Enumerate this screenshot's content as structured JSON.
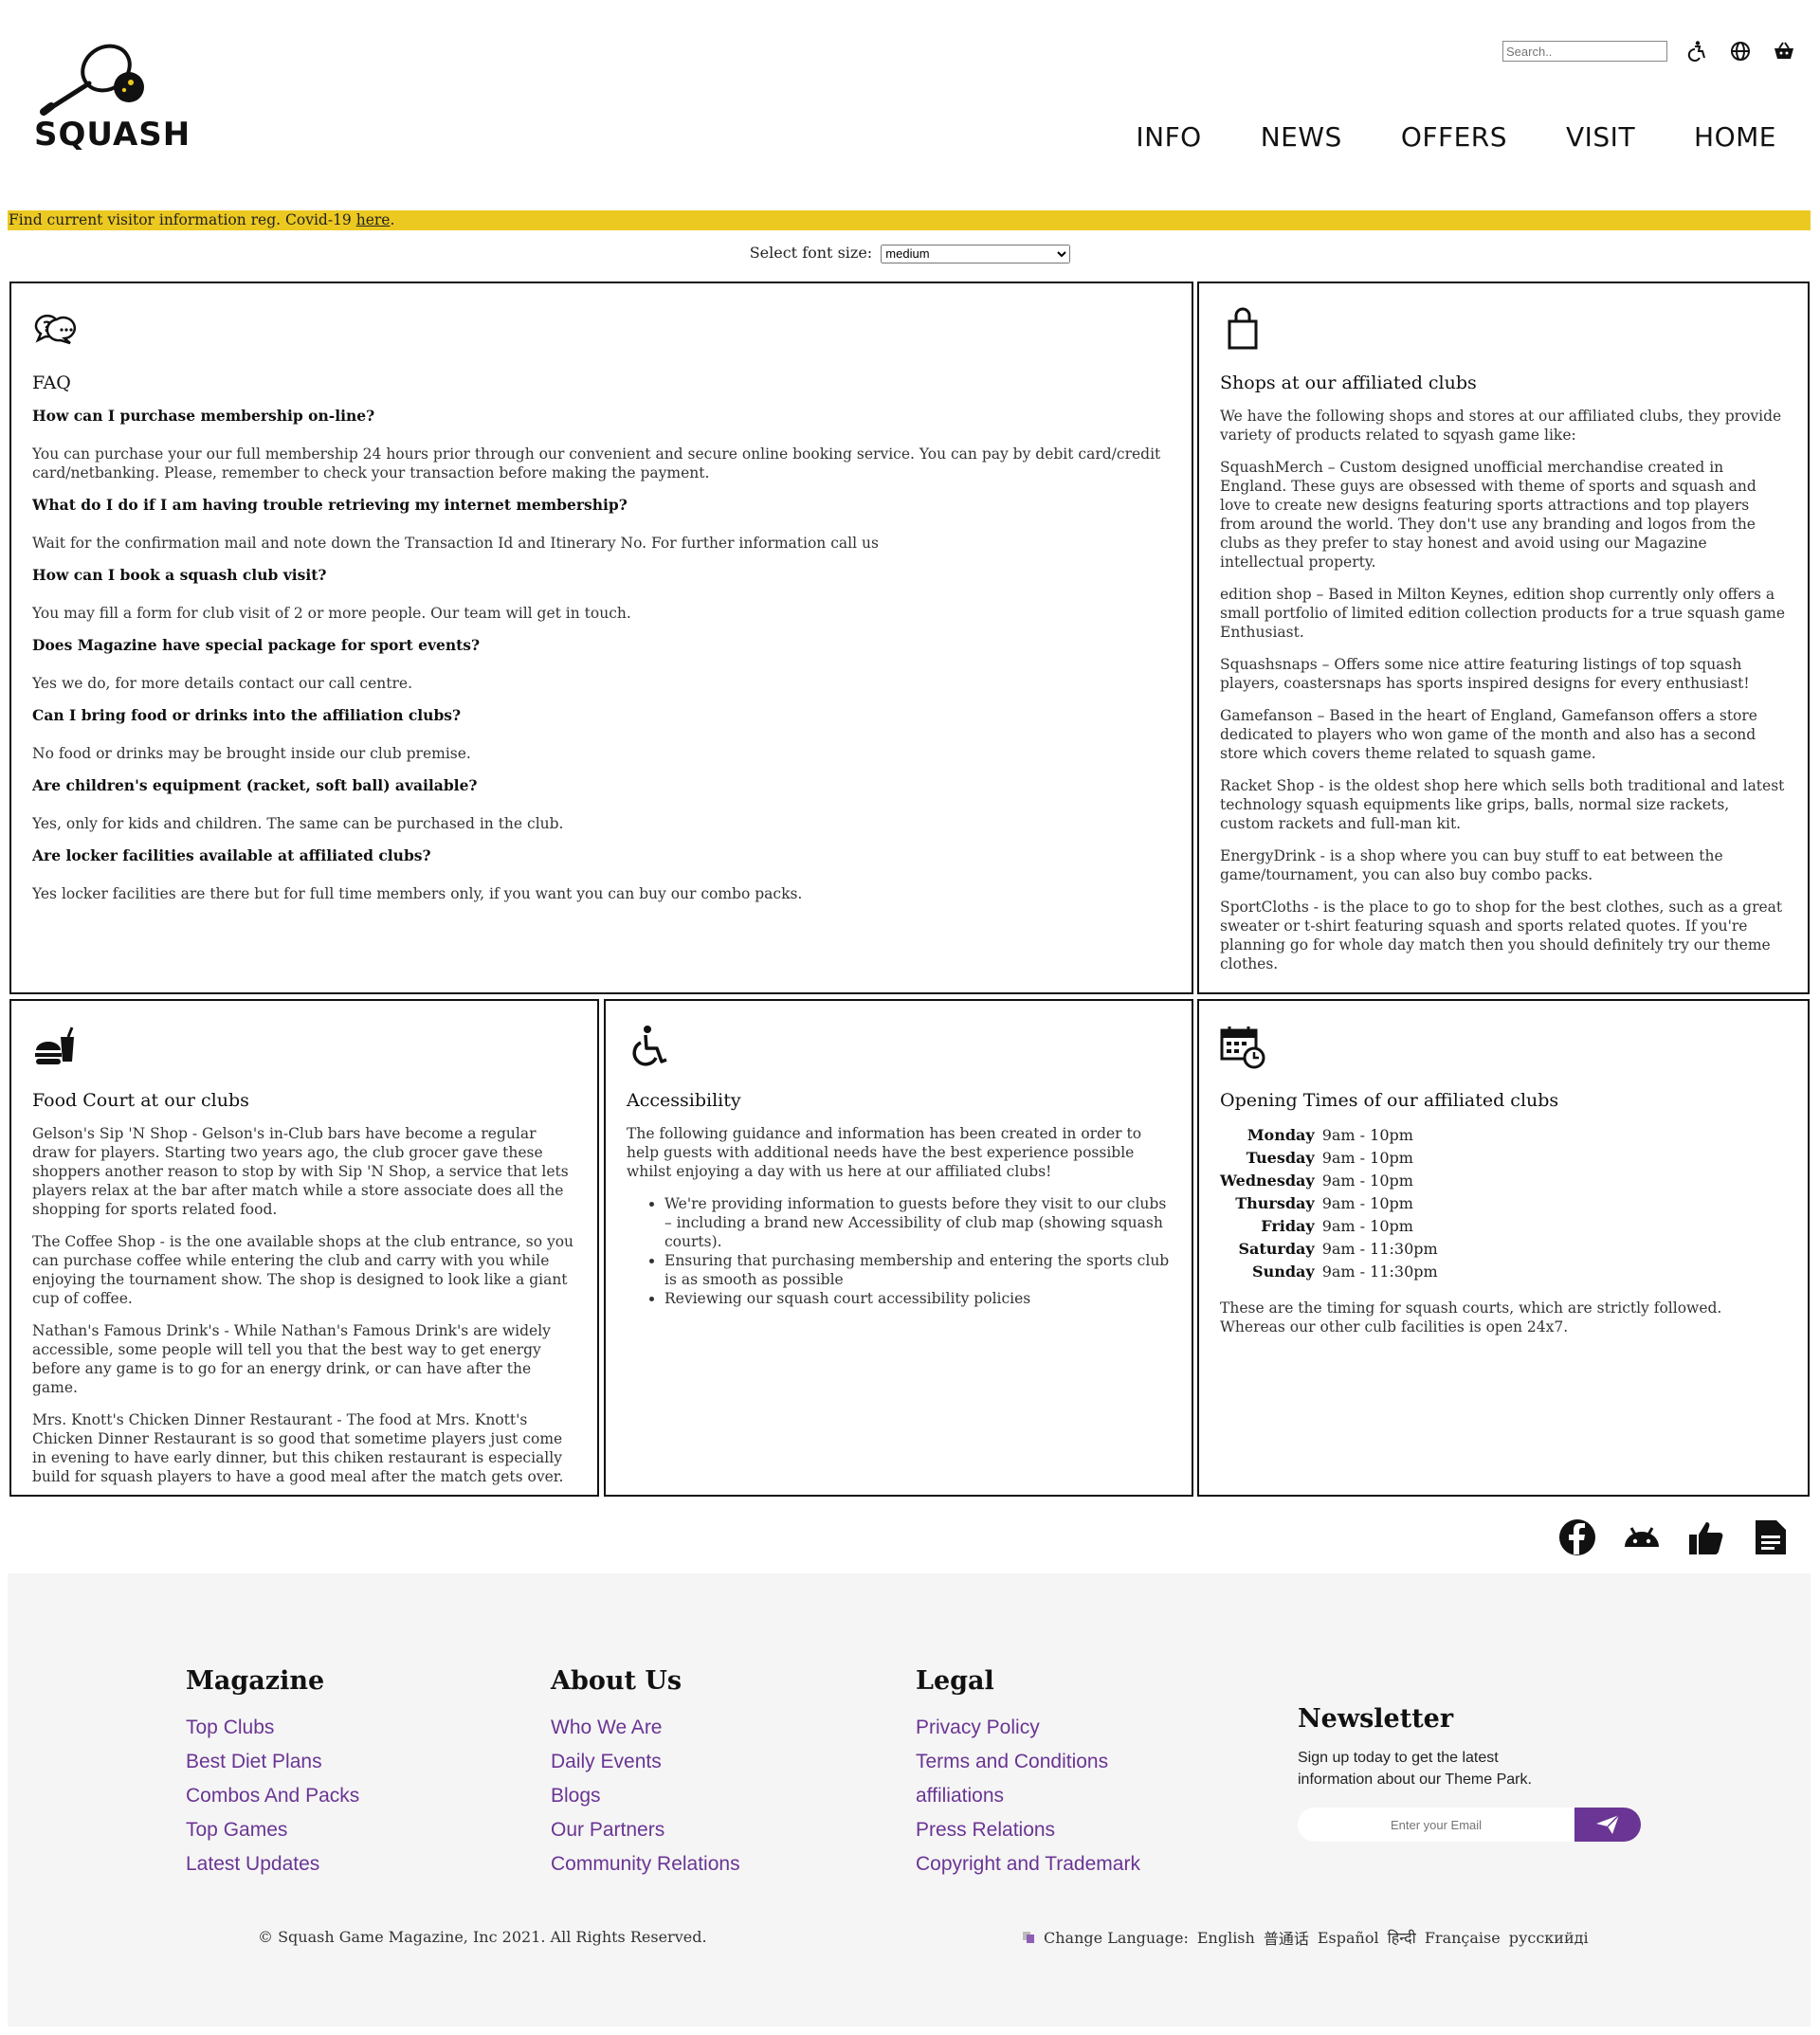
{
  "header": {
    "logo_text": "SQUASH",
    "search_placeholder": "Search..",
    "icons": [
      "accessibility-icon",
      "globe-icon",
      "basket-icon"
    ],
    "nav": [
      "INFO",
      "NEWS",
      "OFFERS",
      "VISIT",
      "HOME"
    ]
  },
  "banner": {
    "text": "Find current visitor information reg. Covid-19 ",
    "link": "here",
    "suffix": "."
  },
  "font_size": {
    "label": "Select font size:",
    "selected": "medium"
  },
  "faq": {
    "title": "FAQ",
    "items": [
      {
        "q": "How can I purchase membership on-line?",
        "a": "You can purchase your our full membership 24 hours prior through our convenient and secure online booking service. You can pay by debit card/credit card/netbanking. Please, remember to check your transaction before making the payment."
      },
      {
        "q": "What do I do if I am having trouble retrieving my internet membership?",
        "a": "Wait for the confirmation mail and note down the Transaction Id and Itinerary No. For further information call us"
      },
      {
        "q": "How can I book a squash club visit?",
        "a": "You may fill a form for club visit of 2 or more people. Our team will get in touch."
      },
      {
        "q": "Does Magazine have special package for sport events?",
        "a": "Yes we do, for more details contact our call centre."
      },
      {
        "q": "Can I bring food or drinks into the affiliation clubs?",
        "a": "No food or drinks may be brought inside our club premise."
      },
      {
        "q": "Are children's equipment (racket, soft ball) available?",
        "a": "Yes, only for kids and children. The same can be purchased in the club."
      },
      {
        "q": "Are locker facilities available at affiliated clubs?",
        "a": "Yes locker facilities are there but for full time members only, if you want you can buy our combo packs."
      }
    ]
  },
  "shops": {
    "title": "Shops at our affiliated clubs",
    "paragraphs": [
      "We have the following shops and stores at our affiliated clubs, they provide variety of products related to sqyash game like:",
      "SquashMerch – Custom designed unofficial merchandise created in England. These guys are obsessed with theme of sports and squash and love to create new designs featuring sports attractions and top players from around the world. They don't use any branding and logos from the clubs as they prefer to stay honest and avoid using our Magazine intellectual property.",
      "edition shop – Based in Milton Keynes, edition shop currently only offers a small portfolio of limited edition collection products for a true squash game Enthusiast.",
      "Squashsnaps – Offers some nice attire featuring listings of top squash players, coastersnaps has sports inspired designs for every enthusiast!",
      "Gamefanson – Based in the heart of England, Gamefanson offers a store dedicated to players who won game of the month and also has a second store which covers theme related to squash game.",
      "Racket Shop - is the oldest shop here which sells both traditional and latest technology squash equipments like grips, balls, normal size rackets, custom rackets and full-man kit.",
      "EnergyDrink - is a shop where you can buy stuff to eat between the game/tournament, you can also buy combo packs.",
      "SportCloths - is the place to go to shop for the best clothes, such as a great sweater or t-shirt featuring squash and sports related quotes. If you're planning go for whole day match then you should definitely try our theme clothes."
    ]
  },
  "food": {
    "title": "Food Court at our clubs",
    "paragraphs": [
      "Gelson's Sip 'N Shop - Gelson's in-Club bars have become a regular draw for players. Starting two years ago, the club grocer gave these shoppers another reason to stop by with Sip 'N Shop, a service that lets players relax at the bar after match while a store associate does all the shopping for sports related food.",
      "The Coffee Shop - is the one available shops at the club entrance, so you can purchase coffee while entering the club and carry with you while enjoying the tournament show. The shop is designed to look like a giant cup of coffee.",
      "Nathan's Famous Drink's - While Nathan's Famous Drink's are widely accessible, some people will tell you that the best way to get energy before any game is to go for an energy drink, or can have after the game.",
      "Mrs. Knott's Chicken Dinner Restaurant - The food at Mrs. Knott's Chicken Dinner Restaurant is so good that sometime players just come in evening to have early dinner, but this chiken restaurant is especially build for squash players to have a good meal after the match gets over."
    ]
  },
  "accessibility": {
    "title": "Accessibility",
    "intro": "The following guidance and information has been created in order to help guests with additional needs have the best experience possible whilst enjoying a day with us here at our affiliated clubs!",
    "items": [
      "We're providing information to guests before they visit to our clubs – including a brand new Accessibility of club map (showing squash courts).",
      "Ensuring that purchasing membership and entering the sports club is as smooth as possible",
      "Reviewing our squash court accessibility policies"
    ]
  },
  "hours": {
    "title": "Opening Times of our affiliated clubs",
    "rows": [
      {
        "day": "Monday",
        "time": "9am - 10pm"
      },
      {
        "day": "Tuesday",
        "time": "9am - 10pm"
      },
      {
        "day": "Wednesday",
        "time": "9am - 10pm"
      },
      {
        "day": "Thursday",
        "time": "9am - 10pm"
      },
      {
        "day": "Friday",
        "time": "9am - 10pm"
      },
      {
        "day": "Saturday",
        "time": "9am - 11:30pm"
      },
      {
        "day": "Sunday",
        "time": "9am - 11:30pm"
      }
    ],
    "note": "These are the timing for squash courts, which are strictly followed. Whereas our other culb facilities is open 24x7."
  },
  "social": [
    "facebook-icon",
    "android-icon",
    "thumbs-up-icon",
    "document-icon"
  ],
  "footer": {
    "columns": [
      {
        "title": "Magazine",
        "links": [
          "Top Clubs",
          "Best Diet Plans",
          "Combos And Packs",
          "Top Games",
          "Latest Updates"
        ]
      },
      {
        "title": "About Us",
        "links": [
          "Who We Are",
          "Daily Events",
          "Blogs",
          "Our Partners",
          "Community Relations"
        ]
      },
      {
        "title": "Legal",
        "links": [
          "Privacy Policy",
          "Terms and Conditions",
          "affiliations",
          "Press Relations",
          "Copyright and Trademark"
        ]
      }
    ],
    "newsletter": {
      "title": "Newsletter",
      "text": "Sign up today to get the latest information about our Theme Park.",
      "placeholder": "Enter your Email"
    },
    "copyright": "© Squash Game Magazine, Inc 2021. All Rights Reserved.",
    "language_label": "Change Language:",
    "languages": [
      "English",
      "普通话",
      "Español",
      "हिन्दी",
      "Française",
      "русскийді"
    ]
  },
  "colors": {
    "banner": "#ecc920",
    "link": "#6a3594",
    "footer_bg": "#f5f5f5"
  }
}
